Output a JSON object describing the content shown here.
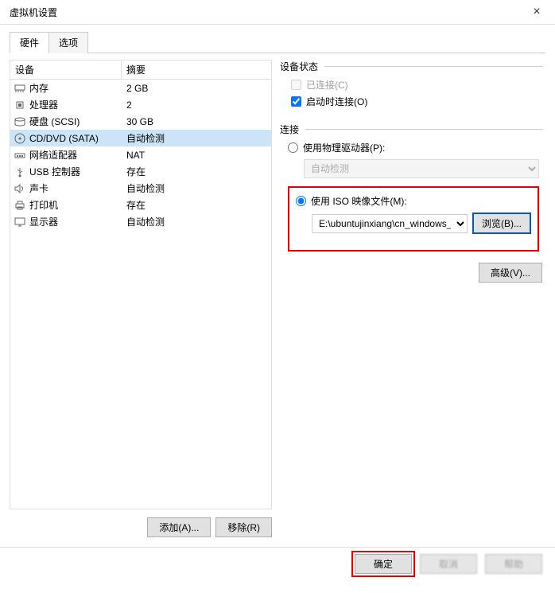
{
  "window": {
    "title": "虚拟机设置"
  },
  "tabs": {
    "hardware": "硬件",
    "options": "选项"
  },
  "table": {
    "header_device": "设备",
    "header_summary": "摘要",
    "rows": [
      {
        "icon": "memory",
        "name": "内存",
        "summary": "2 GB"
      },
      {
        "icon": "cpu",
        "name": "处理器",
        "summary": "2"
      },
      {
        "icon": "disk",
        "name": "硬盘 (SCSI)",
        "summary": "30 GB"
      },
      {
        "icon": "cd",
        "name": "CD/DVD (SATA)",
        "summary": "自动检测",
        "selected": true
      },
      {
        "icon": "net",
        "name": "网络适配器",
        "summary": "NAT"
      },
      {
        "icon": "usb",
        "name": "USB 控制器",
        "summary": "存在"
      },
      {
        "icon": "sound",
        "name": "声卡",
        "summary": "自动检测"
      },
      {
        "icon": "printer",
        "name": "打印机",
        "summary": "存在"
      },
      {
        "icon": "display",
        "name": "显示器",
        "summary": "自动检测"
      }
    ]
  },
  "left_buttons": {
    "add": "添加(A)...",
    "remove": "移除(R)"
  },
  "device_status": {
    "group_label": "设备状态",
    "connected": "已连接(C)",
    "connect_at_poweron": "启动时连接(O)"
  },
  "connection": {
    "group_label": "连接",
    "use_physical": "使用物理驱动器(P):",
    "physical_value": "自动检测",
    "use_iso": "使用 ISO 映像文件(M):",
    "iso_path": "E:\\ubuntujinxiang\\cn_windows_",
    "browse": "浏览(B)..."
  },
  "advanced": "高级(V)...",
  "footer": {
    "ok": "确定",
    "cancel": "取消",
    "help": "帮助"
  }
}
